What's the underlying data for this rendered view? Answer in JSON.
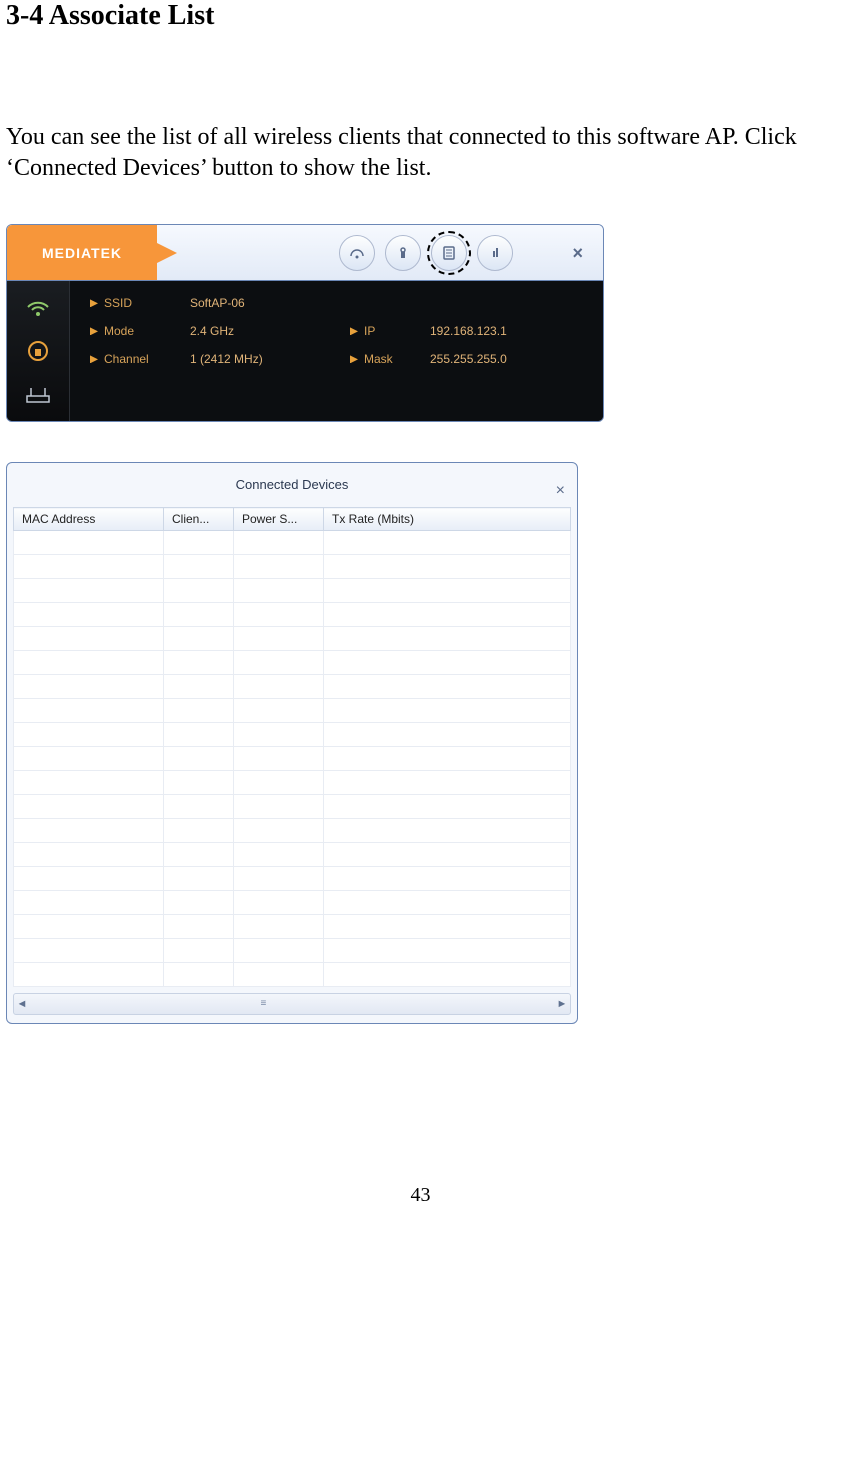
{
  "heading": "3-4 Associate List",
  "body_text": "You can see the list of all wireless clients that connected to this software AP. Click ‘Connected Devices’ button to show the list.",
  "app": {
    "brand": "MEDIATEK",
    "info": {
      "ssid_label": "SSID",
      "ssid_value": "SoftAP-06",
      "mode_label": "Mode",
      "mode_value": "2.4 GHz",
      "channel_label": "Channel",
      "channel_value": "1 (2412 MHz)",
      "ip_label": "IP",
      "ip_value": "192.168.123.1",
      "mask_label": "Mask",
      "mask_value": "255.255.255.0"
    }
  },
  "devices_panel": {
    "title": "Connected Devices",
    "columns": {
      "mac": "MAC Address",
      "clien": "Clien...",
      "power": "Power S...",
      "tx": "Tx Rate (Mbits)"
    }
  },
  "page_number": "43"
}
